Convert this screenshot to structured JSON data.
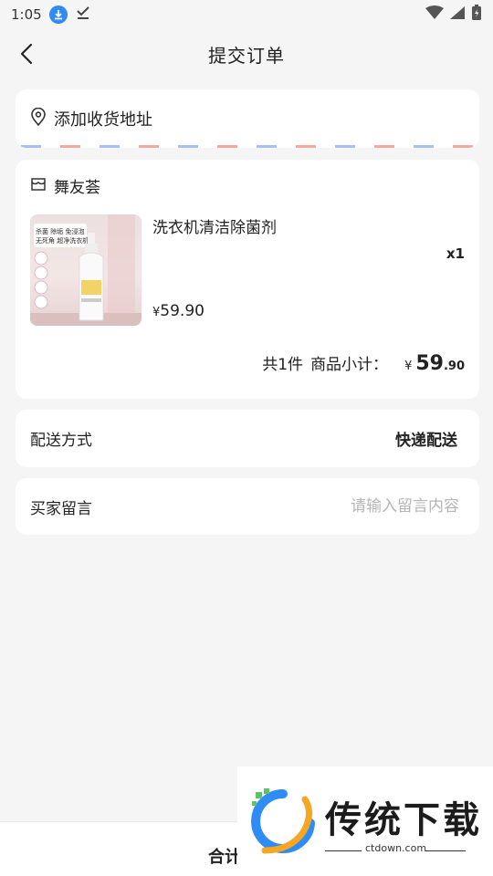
{
  "status_bar": {
    "time": "1:05"
  },
  "header": {
    "title": "提交订单"
  },
  "address": {
    "label": "添加收货地址"
  },
  "shop": {
    "name": "舞友荟",
    "product": {
      "name": "洗衣机清洁除菌剂",
      "quantity": "x1",
      "price_symbol": "¥",
      "price": "59.90",
      "image_texts": [
        "杀菌 除垢 免浸泡",
        "无死角 超净洗衣机"
      ]
    },
    "summary": {
      "count_text": "共1件",
      "subtotal_label": "商品小计：",
      "currency": "¥",
      "subtotal_int": "59",
      "subtotal_dec": ".90"
    }
  },
  "shipping": {
    "label": "配送方式",
    "value": "快递配送"
  },
  "message": {
    "label": "买家留言",
    "placeholder": "请输入留言内容"
  },
  "bottom": {
    "total_label": "合计"
  },
  "watermark": {
    "brand": "传统下载",
    "url": "ctdown.com"
  },
  "colors": {
    "accent_blue": "#2f8cf7",
    "stripe_blue": "#a9bff2",
    "stripe_red": "#f3a8a0"
  }
}
